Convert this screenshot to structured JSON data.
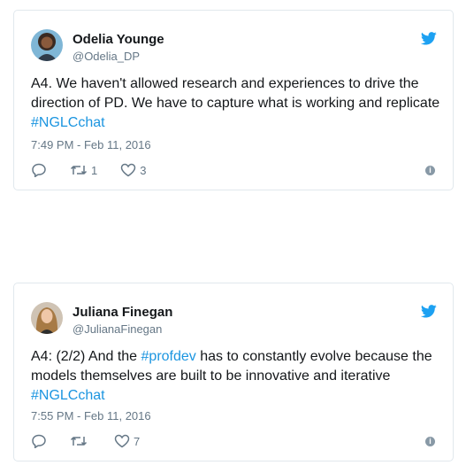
{
  "colors": {
    "link": "#1b95e0",
    "muted": "#657786",
    "border": "#e1e8ed"
  },
  "tweets": [
    {
      "name": "Odelia Younge",
      "handle": "@Odelia_DP",
      "text_main": "A4. We haven't allowed research and experiences to drive the direction of PD. We have to capture what is working and replicate ",
      "hashtag": "#NGLCchat",
      "timestamp": "7:49 PM - Feb 11, 2016",
      "retweets": "1",
      "likes": "3",
      "icons": [
        "reply-icon",
        "retweet-icon",
        "like-icon",
        "info-icon",
        "twitter-bird-icon"
      ]
    },
    {
      "name": "Juliana Finegan",
      "handle": "@JulianaFinegan",
      "text_pre": "A4: (2/2) And the ",
      "hashtag1": "#profdev",
      "text_mid": " has to constantly evolve because the models themselves are built to be innovative and iterative ",
      "hashtag2": "#NGLCchat",
      "timestamp": "7:55 PM - Feb 11, 2016",
      "retweets": "",
      "likes": "7",
      "icons": [
        "reply-icon",
        "retweet-icon",
        "like-icon",
        "info-icon",
        "twitter-bird-icon"
      ]
    }
  ]
}
